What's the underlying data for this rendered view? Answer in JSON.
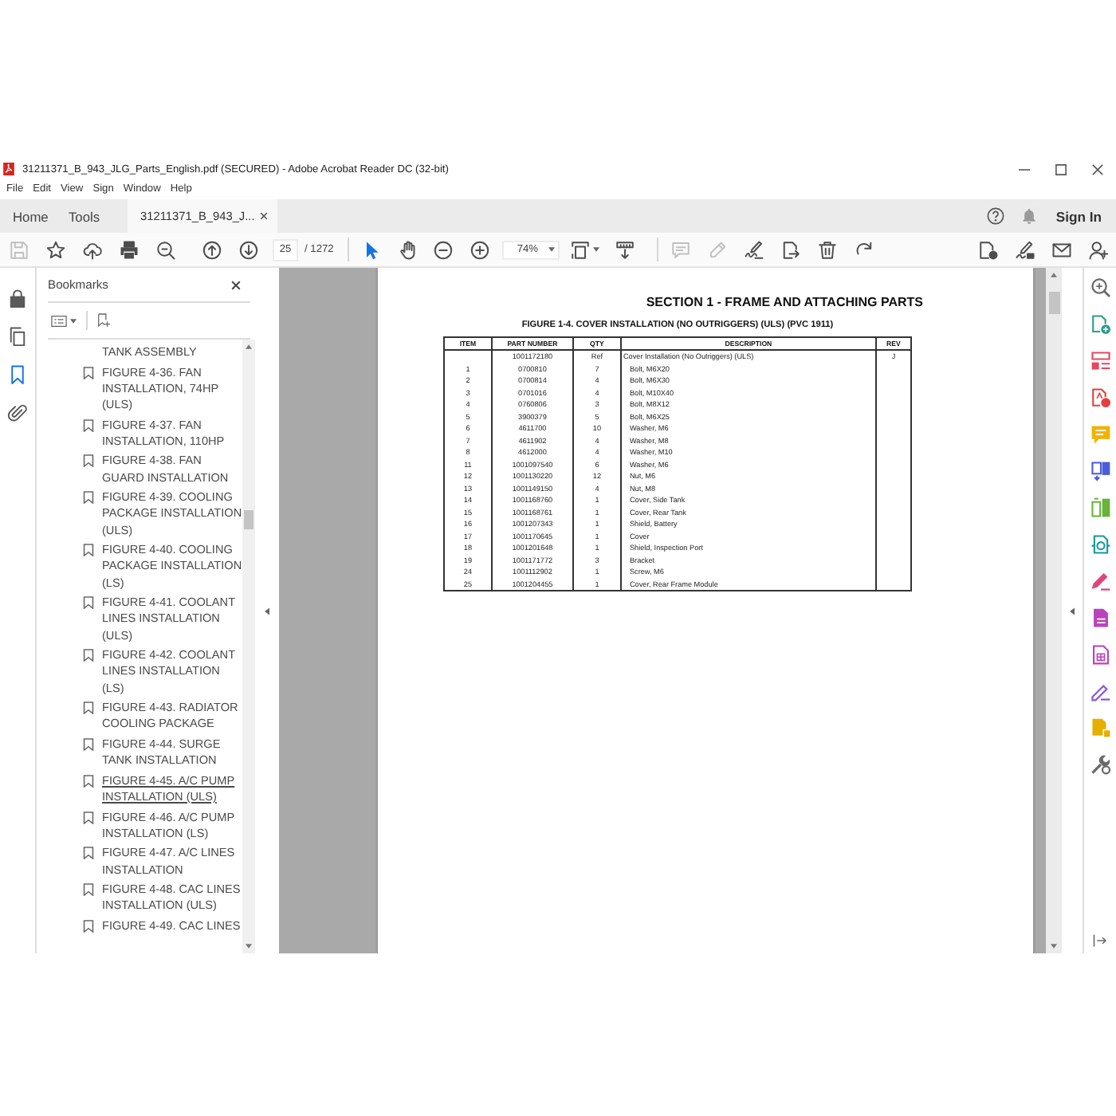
{
  "window": {
    "title": "31211371_B_943_JLG_Parts_English.pdf (SECURED) - Adobe Acrobat Reader DC (32-bit)"
  },
  "menu": [
    "File",
    "Edit",
    "View",
    "Sign",
    "Window",
    "Help"
  ],
  "tabs": [
    {
      "label": "Home",
      "selected": false
    },
    {
      "label": "Tools",
      "selected": false
    },
    {
      "label": "31211371_B_943_J...",
      "selected": true
    }
  ],
  "account": {
    "label": "Sign In"
  },
  "toolbar": {
    "file_buttons": [
      {
        "kind": "save",
        "disabled": true
      },
      {
        "kind": "star",
        "disabled": false
      },
      {
        "kind": "upload",
        "disabled": false
      },
      {
        "kind": "print",
        "disabled": false
      },
      {
        "kind": "find",
        "disabled": false
      }
    ],
    "nav_buttons": [
      {
        "kind": "previous"
      },
      {
        "kind": "next"
      }
    ],
    "page": {
      "value": "25",
      "total": "/ 1272"
    },
    "tool_buttons": [
      {
        "kind": "select",
        "selected": true
      },
      {
        "kind": "hand",
        "selected": false
      }
    ],
    "zoom_buttons": [
      {
        "kind": "zoom_out"
      },
      {
        "kind": "zoom_in"
      }
    ],
    "zoom": {
      "value": "74%"
    },
    "view_buttons": [
      {
        "kind": "fit"
      },
      {
        "kind": "scroll"
      }
    ],
    "edit_buttons": [
      {
        "kind": "comment",
        "disabled": true
      },
      {
        "kind": "highlight",
        "disabled": true
      },
      {
        "kind": "sign",
        "disabled": false
      },
      {
        "kind": "send",
        "disabled": false
      },
      {
        "kind": "delete",
        "disabled": false
      },
      {
        "kind": "rotate",
        "disabled": false
      }
    ],
    "share_buttons": [
      {
        "kind": "create"
      },
      {
        "kind": "fill_sign"
      },
      {
        "kind": "email"
      },
      {
        "kind": "add_user"
      }
    ]
  },
  "side_rail": [
    {
      "kind": "lock",
      "selected": false
    },
    {
      "kind": "pages",
      "selected": false
    },
    {
      "kind": "bookmarks",
      "selected": true
    },
    {
      "kind": "attachments",
      "selected": false
    }
  ],
  "bookmarks": {
    "title": "Bookmarks",
    "items": [
      {
        "kind": "continuation",
        "label": "TANK ASSEMBLY",
        "hovered": false
      },
      {
        "kind": "bookmark",
        "label": "FIGURE 4-36. FAN INSTALLATION, 74HP (ULS)",
        "hovered": false
      },
      {
        "kind": "bookmark",
        "label": "FIGURE 4-37. FAN INSTALLATION, 110HP",
        "hovered": false
      },
      {
        "kind": "bookmark",
        "label": "FIGURE 4-38. FAN GUARD INSTALLATION",
        "hovered": false
      },
      {
        "kind": "bookmark",
        "label": "FIGURE 4-39. COOLING PACKAGE INSTALLATION (ULS)",
        "hovered": false
      },
      {
        "kind": "bookmark",
        "label": "FIGURE 4-40. COOLING PACKAGE INSTALLATION (LS)",
        "hovered": false
      },
      {
        "kind": "bookmark",
        "label": "FIGURE 4-41. COOLANT LINES INSTALLATION (ULS)",
        "hovered": false
      },
      {
        "kind": "bookmark",
        "label": "FIGURE 4-42. COOLANT LINES INSTALLATION (LS)",
        "hovered": false
      },
      {
        "kind": "bookmark",
        "label": "FIGURE 4-43. RADIATOR COOLING PACKAGE",
        "hovered": false
      },
      {
        "kind": "bookmark",
        "label": "FIGURE 4-44. SURGE TANK INSTALLATION",
        "hovered": false
      },
      {
        "kind": "bookmark",
        "label": "FIGURE 4-45. A/C PUMP INSTALLATION (ULS)",
        "hovered": true
      },
      {
        "kind": "bookmark",
        "label": "FIGURE 4-46. A/C PUMP INSTALLATION (LS)",
        "hovered": false
      },
      {
        "kind": "bookmark",
        "label": "FIGURE 4-47. A/C LINES INSTALLATION",
        "hovered": false
      },
      {
        "kind": "bookmark",
        "label": "FIGURE 4-48. CAC LINES INSTALLATION (ULS)",
        "hovered": false
      },
      {
        "kind": "bookmark",
        "label": "FIGURE 4-49. CAC LINES",
        "hovered": false
      }
    ]
  },
  "document": {
    "section_title": "SECTION 1 - FRAME AND ATTACHING PARTS",
    "figure_title": "FIGURE 1-4. COVER INSTALLATION (NO OUTRIGGERS) (ULS) (PVC 1911)",
    "table": {
      "columns": [
        "ITEM",
        "PART NUMBER",
        "QTY",
        "DESCRIPTION",
        "REV"
      ],
      "rows": [
        {
          "kind": "assembly",
          "part_number": "1001172180",
          "qty": "Ref",
          "description": "Cover Installation (No Outriggers) (ULS)",
          "rev": "J"
        },
        {
          "kind": "part",
          "item": "1",
          "part_number": "0700810",
          "qty": "7",
          "description": "Bolt, M6X20"
        },
        {
          "kind": "part",
          "item": "2",
          "part_number": "0700814",
          "qty": "4",
          "description": "Bolt, M6X30"
        },
        {
          "kind": "part",
          "item": "3",
          "part_number": "0701016",
          "qty": "4",
          "description": "Bolt, M10X40"
        },
        {
          "kind": "part",
          "item": "4",
          "part_number": "0760806",
          "qty": "3",
          "description": "Bolt, M8X12"
        },
        {
          "kind": "part",
          "item": "5",
          "part_number": "3900379",
          "qty": "5",
          "description": "Bolt, M6X25"
        },
        {
          "kind": "part",
          "item": "6",
          "part_number": "4611700",
          "qty": "10",
          "description": "Washer, M6"
        },
        {
          "kind": "part",
          "item": "7",
          "part_number": "4611902",
          "qty": "4",
          "description": "Washer, M8"
        },
        {
          "kind": "part",
          "item": "8",
          "part_number": "4612000",
          "qty": "4",
          "description": "Washer, M10"
        },
        {
          "kind": "part",
          "item": "11",
          "part_number": "1001097540",
          "qty": "6",
          "description": "Washer, M6"
        },
        {
          "kind": "part",
          "item": "12",
          "part_number": "1001130220",
          "qty": "12",
          "description": "Nut, M6"
        },
        {
          "kind": "part",
          "item": "13",
          "part_number": "1001149150",
          "qty": "4",
          "description": "Nut, M8"
        },
        {
          "kind": "part",
          "item": "14",
          "part_number": "1001168760",
          "qty": "1",
          "description": "Cover, Side Tank"
        },
        {
          "kind": "part",
          "item": "15",
          "part_number": "1001168761",
          "qty": "1",
          "description": "Cover, Rear Tank"
        },
        {
          "kind": "part",
          "item": "16",
          "part_number": "1001207343",
          "qty": "1",
          "description": "Shield, Battery"
        },
        {
          "kind": "part",
          "item": "17",
          "part_number": "1001170645",
          "qty": "1",
          "description": "Cover"
        },
        {
          "kind": "part",
          "item": "18",
          "part_number": "1001201648",
          "qty": "1",
          "description": "Shield, Inspection Port"
        },
        {
          "kind": "part",
          "item": "19",
          "part_number": "1001171772",
          "qty": "3",
          "description": "Bracket"
        },
        {
          "kind": "part",
          "item": "24",
          "part_number": "1001112902",
          "qty": "1",
          "description": "Screw, M6"
        },
        {
          "kind": "part",
          "item": "25",
          "part_number": "1001204455",
          "qty": "1",
          "description": "Cover, Rear Frame Module"
        }
      ]
    }
  }
}
